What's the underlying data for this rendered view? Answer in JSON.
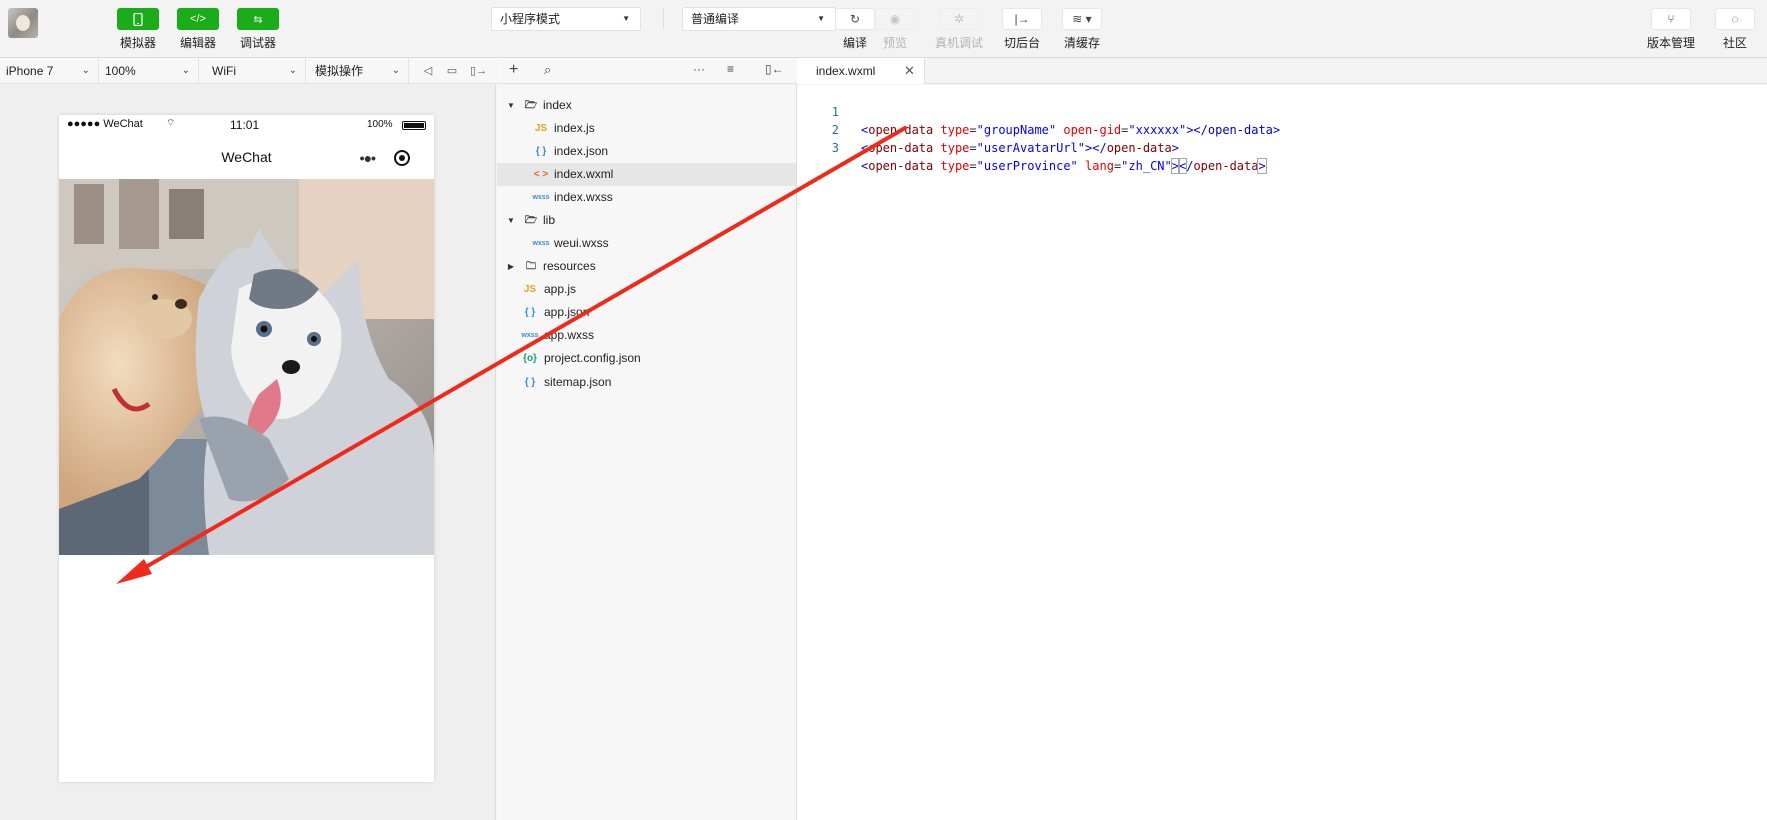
{
  "toolbar": {
    "simulator_label": "模拟器",
    "editor_label": "编辑器",
    "debugger_label": "调试器",
    "mode_select": "小程序模式",
    "compile_select": "普通编译",
    "compile_label": "编译",
    "preview_label": "预览",
    "remote_debug_label": "真机调试",
    "background_label": "切后台",
    "clear_cache_label": "清缓存",
    "version_label": "版本管理",
    "community_label": "社区"
  },
  "simulator": {
    "device": "iPhone 7",
    "zoom": "100%",
    "network": "WiFi",
    "operation": "模拟操作",
    "status": {
      "carrier": "●●●●● WeChat",
      "time": "11:01",
      "battery": "100%"
    },
    "nav_title": "WeChat"
  },
  "tree": {
    "items": [
      {
        "name": "index",
        "type": "folder-open"
      },
      {
        "name": "index.js",
        "type": "js",
        "icon": "JS"
      },
      {
        "name": "index.json",
        "type": "json",
        "icon": "{ }"
      },
      {
        "name": "index.wxml",
        "type": "wxml",
        "icon": "< >"
      },
      {
        "name": "index.wxss",
        "type": "wxss",
        "icon": "wxss"
      },
      {
        "name": "lib",
        "type": "folder-open"
      },
      {
        "name": "weui.wxss",
        "type": "wxss",
        "icon": "wxss"
      },
      {
        "name": "resources",
        "type": "folder-closed"
      },
      {
        "name": "app.js",
        "type": "js",
        "icon": "JS"
      },
      {
        "name": "app.json",
        "type": "json",
        "icon": "{ }"
      },
      {
        "name": "app.wxss",
        "type": "wxss",
        "icon": "wxss"
      },
      {
        "name": "project.config.json",
        "type": "config",
        "icon": "{o}"
      },
      {
        "name": "sitemap.json",
        "type": "json",
        "icon": "{ }"
      }
    ],
    "selected": "index.wxml"
  },
  "editor": {
    "tab": "index.wxml",
    "lines": [
      {
        "n": "1",
        "text": "<open-data type=\"groupName\" open-gid=\"xxxxxx\"></open-data>"
      },
      {
        "n": "2",
        "text": "<open-data type=\"userAvatarUrl\"></open-data>"
      },
      {
        "n": "3",
        "text": "<open-data type=\"userProvince\" lang=\"zh_CN\"></open-data>"
      }
    ]
  },
  "colors": {
    "accent_green": "#1aad19",
    "annotation_arrow": "#f02a1a",
    "code_tag": "#800000",
    "code_attr": "#e00000",
    "code_value": "#0000ff"
  }
}
